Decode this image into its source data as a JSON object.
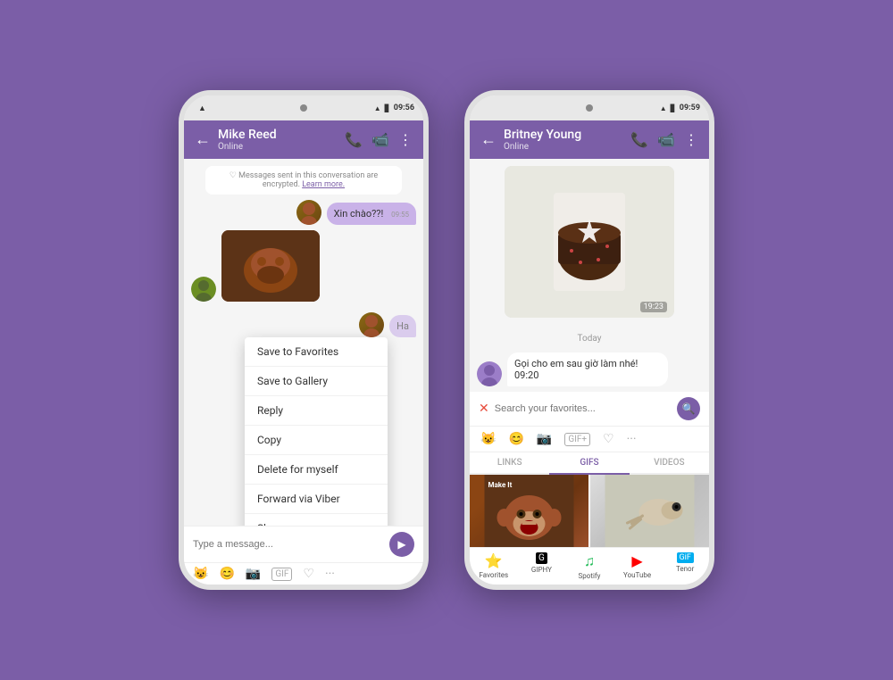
{
  "background_color": "#7B5EA7",
  "phone_left": {
    "status_bar": {
      "time": "09:56",
      "icons": [
        "signal",
        "wifi",
        "battery"
      ]
    },
    "header": {
      "name": "Mike Reed",
      "status": "Online",
      "back_label": "←",
      "phone_icon": "📞",
      "video_icon": "📹",
      "more_icon": "⋮"
    },
    "encryption_notice": "Messages sent in this conversation are encrypted.",
    "learn_more": "Learn more.",
    "messages": [
      {
        "type": "sent",
        "text": "Xin chào??!",
        "time": "09:55"
      },
      {
        "type": "received_image",
        "time": ""
      },
      {
        "type": "sent",
        "text": "Ha",
        "time": ""
      }
    ],
    "context_menu": {
      "items": [
        "Save to Favorites",
        "Save to Gallery",
        "Reply",
        "Copy",
        "Delete for myself",
        "Forward via Viber",
        "Share"
      ]
    },
    "input_placeholder": "Type a message...",
    "toolbar_icons": [
      "😺",
      "😊",
      "📷",
      "GIF",
      "♡",
      "···"
    ]
  },
  "phone_right": {
    "status_bar": {
      "time": "09:59"
    },
    "header": {
      "name": "Britney Young",
      "status": "Online",
      "back_label": "←"
    },
    "photo_time": "19:23",
    "date_divider": "Today",
    "received_message": {
      "text": "Gọi cho em sau giờ làm nhé!",
      "time": "09:20"
    },
    "search_placeholder": "Search your favorites...",
    "media_icons": [
      "😺",
      "😊",
      "📷",
      "GIF+",
      "♡",
      "···"
    ],
    "tabs": [
      "LINKS",
      "GIFS",
      "VIDEOS"
    ],
    "active_tab": "GIFS",
    "app_bar": [
      {
        "icon": "⭐",
        "label": "Favorites",
        "class": "star"
      },
      {
        "icon": "G",
        "label": "GIPHY",
        "class": "giphy"
      },
      {
        "icon": "♫",
        "label": "Spotify",
        "class": "spotify"
      },
      {
        "icon": "▶",
        "label": "YouTube",
        "class": "youtube"
      },
      {
        "icon": "GiF",
        "label": "Tenor",
        "class": "tenor"
      }
    ]
  }
}
